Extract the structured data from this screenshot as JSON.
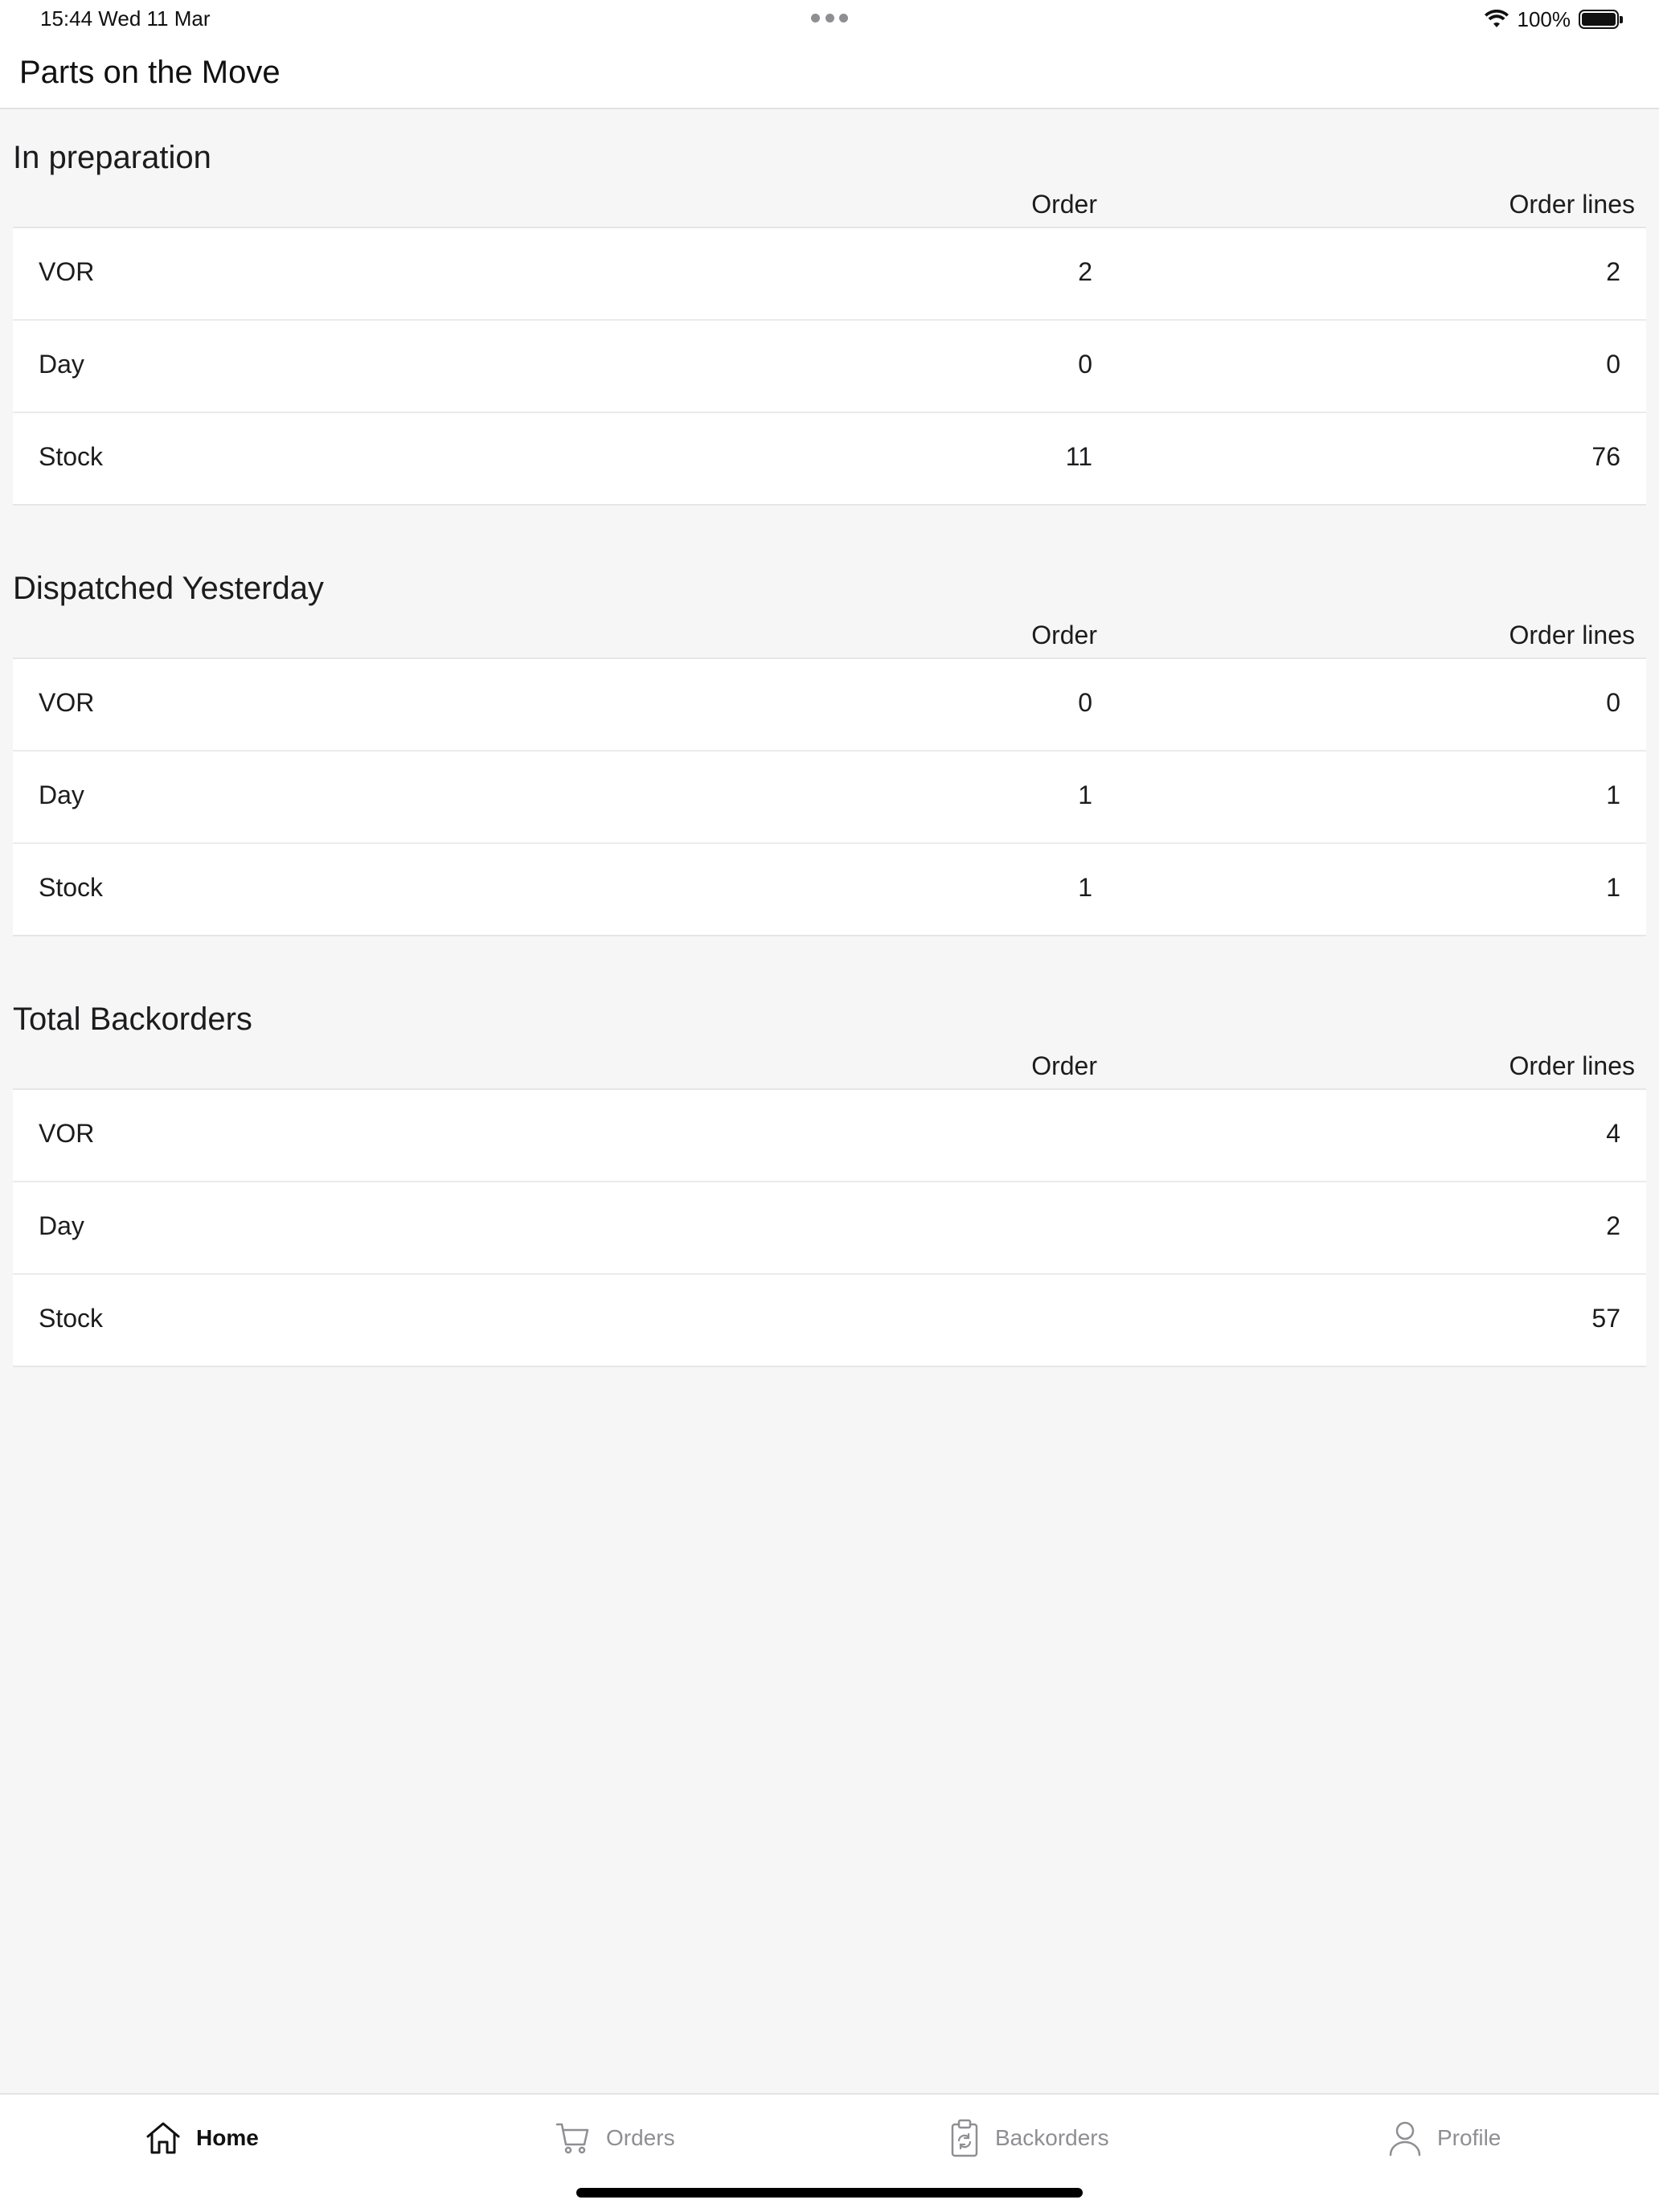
{
  "status_bar": {
    "time_date": "15:44   Wed 11 Mar",
    "battery": "100%"
  },
  "header": {
    "title": "Parts on the Move"
  },
  "sections": [
    {
      "title": "In preparation",
      "col_order": "Order",
      "col_lines": "Order lines",
      "rows": [
        {
          "label": "VOR",
          "order": "2",
          "lines": "2"
        },
        {
          "label": "Day",
          "order": "0",
          "lines": "0"
        },
        {
          "label": "Stock",
          "order": "11",
          "lines": "76"
        }
      ]
    },
    {
      "title": "Dispatched Yesterday",
      "col_order": "Order",
      "col_lines": "Order lines",
      "rows": [
        {
          "label": "VOR",
          "order": "0",
          "lines": "0"
        },
        {
          "label": "Day",
          "order": "1",
          "lines": "1"
        },
        {
          "label": "Stock",
          "order": "1",
          "lines": "1"
        }
      ]
    },
    {
      "title": "Total Backorders",
      "col_order": "Order",
      "col_lines": "Order lines",
      "rows": [
        {
          "label": "VOR",
          "order": "",
          "lines": "4"
        },
        {
          "label": "Day",
          "order": "",
          "lines": "2"
        },
        {
          "label": "Stock",
          "order": "",
          "lines": "57"
        }
      ]
    }
  ],
  "tabs": [
    {
      "label": "Home",
      "icon": "home-icon",
      "active": true
    },
    {
      "label": "Orders",
      "icon": "cart-icon",
      "active": false
    },
    {
      "label": "Backorders",
      "icon": "clipboard-refresh-icon",
      "active": false
    },
    {
      "label": "Profile",
      "icon": "person-icon",
      "active": false
    }
  ]
}
